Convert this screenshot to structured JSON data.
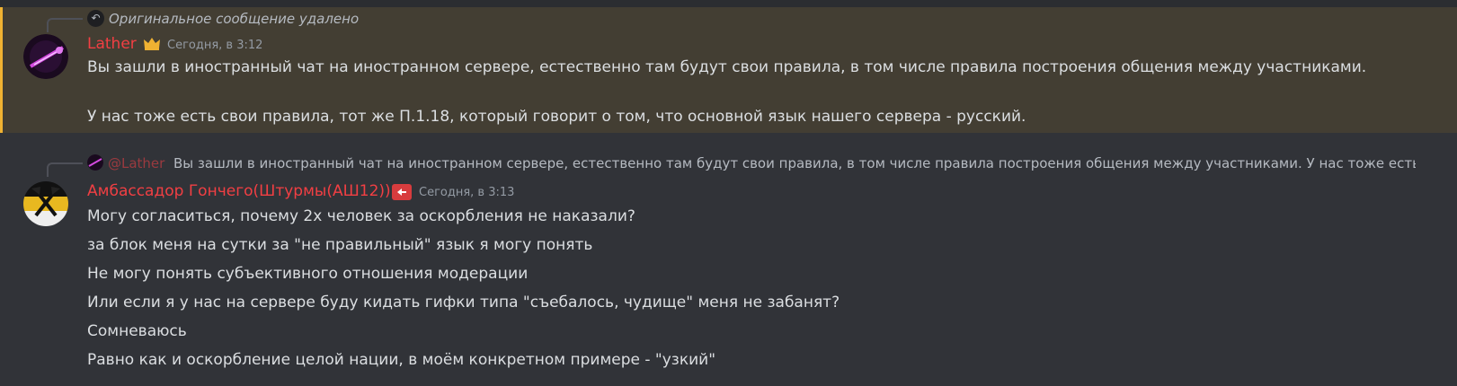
{
  "colors": {
    "background": "#313338",
    "highlight_background": "#433e33",
    "highlight_bar": "#f0b232",
    "username_red": "#f23f43",
    "text": "#dbdee1",
    "muted_text": "#949ba4"
  },
  "messages": [
    {
      "reply": {
        "icon": "reply-arrow-icon",
        "text": "Оригинальное сообщение удалено"
      },
      "author": "Lather",
      "author_badge_icon": "crown-icon",
      "timestamp": "Сегодня, в 3:12",
      "lines": [
        "Вы зашли в иностранный чат на иностранном сервере, естественно там будут свои правила, в том числе правила построения общения между участниками.",
        "У нас тоже есть свои правила, тот же П.1.18, который говорит о том, что основной язык нашего сервера - русский."
      ]
    },
    {
      "reply": {
        "mention": "@Lather",
        "text": "Вы зашли в иностранный чат на иностранном сервере, естественно там будут свои правила, в том числе правила построения общения между участниками. У нас тоже есть свои пр"
      },
      "author": "Амбассадор Гончего(Штурмы(АШ12))",
      "author_badge_icon": "role-badge-icon",
      "timestamp": "Сегодня, в 3:13",
      "lines": [
        "Могу согласиться, почему 2х человек за оскорбления не наказали?",
        "за блок меня на сутки за \"не правильный\" язык я могу понять",
        "Не могу понять субъективного отношения модерации",
        "Или если я у нас на сервере буду кидать гифки типа \"съебалось, чудище\" меня не забанят?",
        "Сомневаюсь",
        "Равно как и оскорбление целой нации, в моём конкретном примере - \"узкий\""
      ]
    }
  ]
}
